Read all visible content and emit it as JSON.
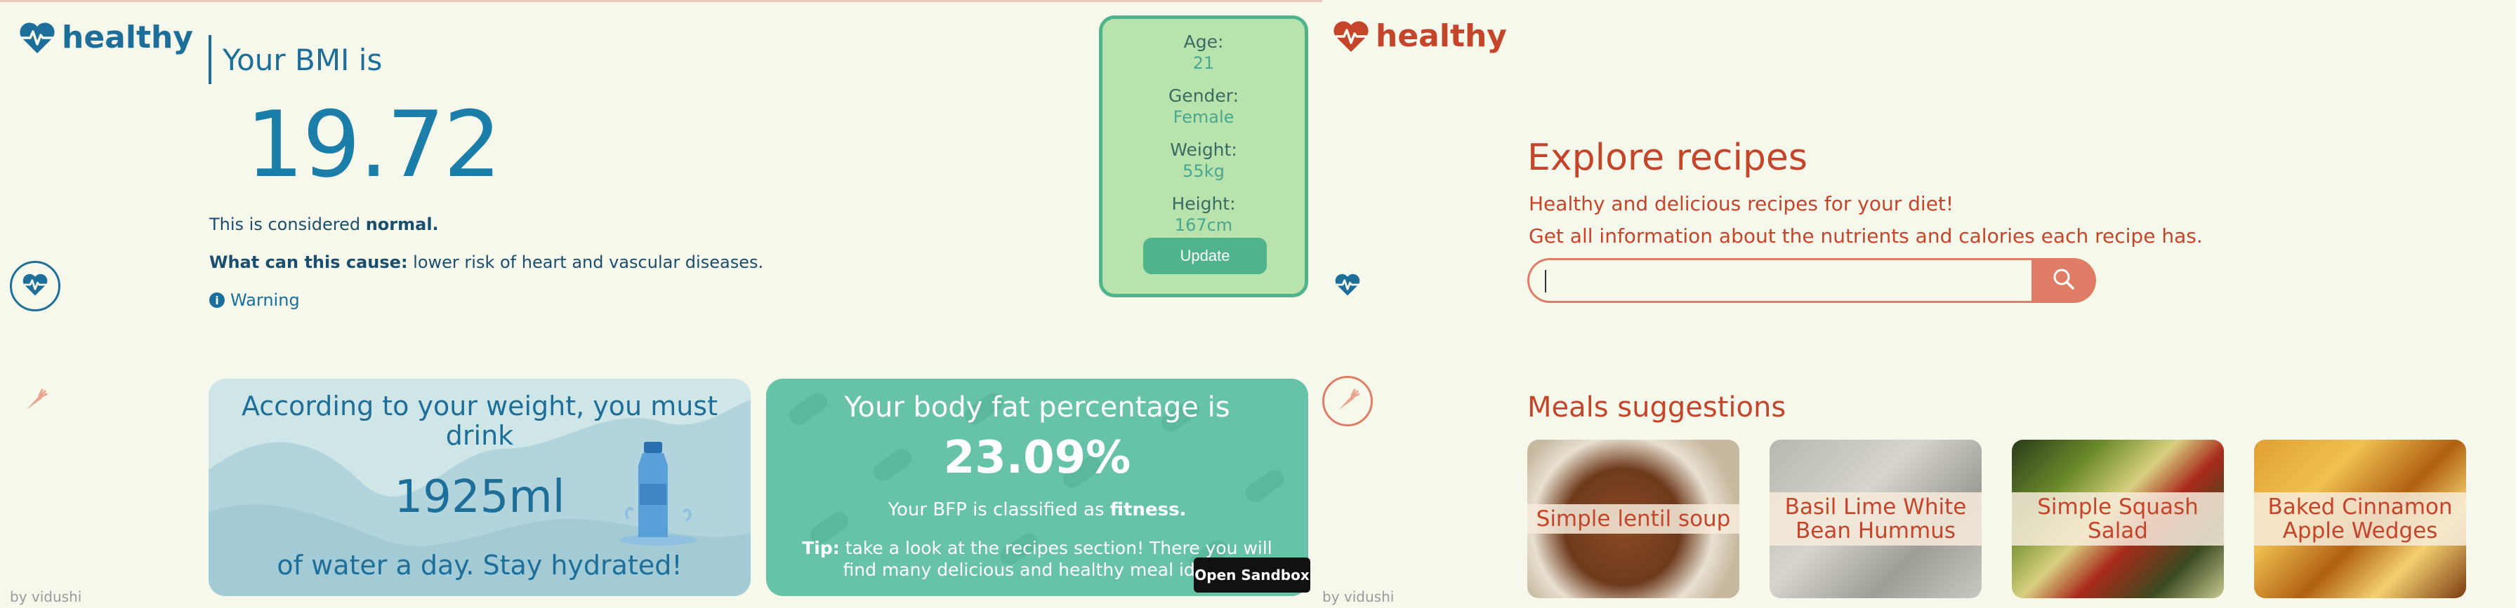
{
  "left": {
    "logo_text": "healthy",
    "bmi_heading": "Your BMI is",
    "bmi_value": "19.72",
    "considered_prefix": "This is considered ",
    "considered_value": "normal.",
    "cause_label": "What can this cause:",
    "cause_text": " lower risk of heart and vascular diseases.",
    "warning_text": "Warning",
    "stats": [
      {
        "label": "Age:",
        "value": "21"
      },
      {
        "label": "Gender:",
        "value": "Female"
      },
      {
        "label": "Weight:",
        "value": "55kg"
      },
      {
        "label": "Height:",
        "value": "167cm"
      }
    ],
    "update_label": "Update",
    "water_line1": "According to your weight, you must drink",
    "water_amount": "1925ml",
    "water_line2": "of water a day. Stay hydrated!",
    "bfp_heading": "Your body fat percentage is",
    "bfp_value": "23.09%",
    "bfp_class_prefix": "Your BFP is classified as ",
    "bfp_class_value": "fitness.",
    "tip_label": "Tip:",
    "tip_text": " take a look at the recipes section! There you will find many delicious and healthy meal ideas.",
    "sandbox_label": "Open Sandbox",
    "byline": "by vidushi"
  },
  "right": {
    "logo_text": "healthy",
    "explore_title": "Explore recipes",
    "explore_sub1": "Healthy and delicious recipes for your diet!",
    "explore_sub2": "Get all information about the nutrients and calories each recipe has.",
    "search_value": "",
    "meals_title": "Meals suggestions",
    "meals": [
      {
        "name": "Simple lentil soup"
      },
      {
        "name": "Basil Lime White Bean Hummus"
      },
      {
        "name": "Simple Squash Salad"
      },
      {
        "name": "Baked Cinnamon Apple Wedges"
      }
    ],
    "byline": "by vidushi"
  },
  "colors": {
    "blue_accent": "#1d6f9a",
    "green_card": "#b8e3ad",
    "teal_card": "#67c3a8",
    "coral_accent": "#c4452a",
    "background": "#f7f8ec"
  },
  "icons": [
    "heart-pulse-icon",
    "carrot-icon",
    "info-icon",
    "search-icon",
    "water-bottle-icon"
  ]
}
